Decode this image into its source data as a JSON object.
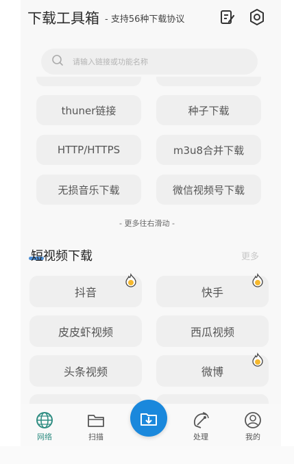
{
  "header": {
    "title": "下载工具箱",
    "subtitle": "- 支持56种下载协议"
  },
  "search": {
    "placeholder": "请输入链接或功能名称"
  },
  "tools": [
    {
      "label": "thuner链接"
    },
    {
      "label": "种子下载"
    },
    {
      "label": "HTTP/HTTPS"
    },
    {
      "label": "m3u8合并下载"
    },
    {
      "label": "无损音乐下载"
    },
    {
      "label": "微信视频号下载"
    }
  ],
  "scroll_hint": "- 更多往右滑动 -",
  "short_video": {
    "title": "短视频下载",
    "more": "更多",
    "items": [
      {
        "label": "抖音",
        "hot": true
      },
      {
        "label": "快手",
        "hot": true
      },
      {
        "label": "皮皮虾视频",
        "hot": false
      },
      {
        "label": "西瓜视频",
        "hot": false
      },
      {
        "label": "头条视频",
        "hot": false
      },
      {
        "label": "微博",
        "hot": true
      }
    ]
  },
  "nav": {
    "items": [
      {
        "label": "网络",
        "icon": "globe-icon",
        "active": true
      },
      {
        "label": "扫描",
        "icon": "folder-icon",
        "active": false
      },
      {
        "label": "处理",
        "icon": "satellite-icon",
        "active": false
      },
      {
        "label": "我的",
        "icon": "user-icon",
        "active": false
      }
    ],
    "center_icon": "download-icon"
  },
  "colors": {
    "accent": "#1a88dc",
    "active_nav": "#2f8d82",
    "hot_badge": "#f5b82e"
  }
}
